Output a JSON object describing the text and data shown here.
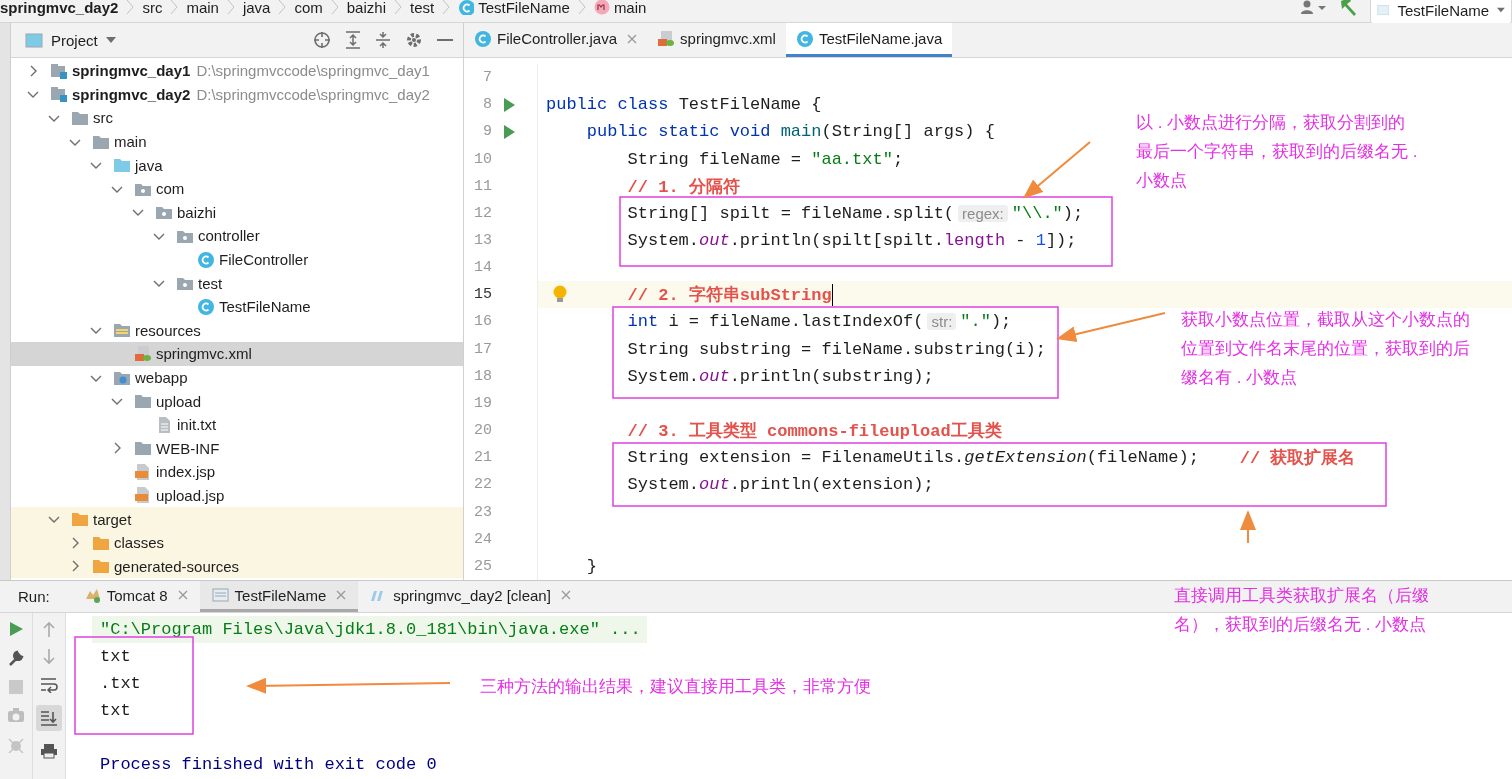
{
  "breadcrumbs": [
    {
      "text": "springmvc_day2",
      "kind": "module"
    },
    {
      "text": "src",
      "kind": "plain"
    },
    {
      "text": "main",
      "kind": "plain"
    },
    {
      "text": "java",
      "kind": "plain"
    },
    {
      "text": "com",
      "kind": "plain"
    },
    {
      "text": "baizhi",
      "kind": "plain"
    },
    {
      "text": "test",
      "kind": "plain"
    },
    {
      "text": "TestFileName",
      "kind": "class"
    },
    {
      "text": "main",
      "kind": "method"
    }
  ],
  "run_config": {
    "label": "TestFileName"
  },
  "project_panel": {
    "title": "Project",
    "tree": [
      {
        "label": "springmvc_day1",
        "path": "D:\\springmvccode\\springmvc_day1",
        "kind": "module",
        "expanded": false,
        "selected": false
      },
      {
        "label": "springmvc_day2",
        "path": "D:\\springmvccode\\springmvc_day2",
        "kind": "module",
        "expanded": true,
        "selected": false,
        "children": [
          {
            "label": "src",
            "kind": "folder",
            "expanded": true,
            "selected": false,
            "children": [
              {
                "label": "main",
                "kind": "folder",
                "expanded": true,
                "selected": false,
                "children": [
                  {
                    "label": "java",
                    "kind": "source-folder",
                    "expanded": true,
                    "selected": false,
                    "children": [
                      {
                        "label": "com",
                        "kind": "package",
                        "expanded": true,
                        "selected": false,
                        "children": [
                          {
                            "label": "baizhi",
                            "kind": "package",
                            "expanded": true,
                            "selected": false,
                            "children": [
                              {
                                "label": "controller",
                                "kind": "package",
                                "expanded": true,
                                "selected": false,
                                "children": [
                                  {
                                    "label": "FileController",
                                    "kind": "class",
                                    "selected": false
                                  }
                                ]
                              },
                              {
                                "label": "test",
                                "kind": "package",
                                "expanded": true,
                                "selected": false,
                                "children": [
                                  {
                                    "label": "TestFileName",
                                    "kind": "class",
                                    "selected": false
                                  }
                                ]
                              }
                            ]
                          }
                        ]
                      }
                    ]
                  },
                  {
                    "label": "resources",
                    "kind": "resources-folder",
                    "expanded": true,
                    "selected": false,
                    "children": [
                      {
                        "label": "springmvc.xml",
                        "kind": "xml",
                        "selected": true
                      }
                    ]
                  },
                  {
                    "label": "webapp",
                    "kind": "web-folder",
                    "expanded": true,
                    "selected": false,
                    "children": [
                      {
                        "label": "upload",
                        "kind": "folder",
                        "expanded": true,
                        "selected": false,
                        "children": [
                          {
                            "label": "init.txt",
                            "kind": "text-file",
                            "selected": false
                          }
                        ]
                      },
                      {
                        "label": "WEB-INF",
                        "kind": "folder",
                        "expanded": false,
                        "selected": false
                      },
                      {
                        "label": "index.jsp",
                        "kind": "jsp",
                        "selected": false
                      },
                      {
                        "label": "upload.jsp",
                        "kind": "jsp",
                        "selected": false
                      }
                    ]
                  }
                ]
              }
            ]
          },
          {
            "label": "target",
            "kind": "excluded-folder",
            "expanded": true,
            "selected": false,
            "children": [
              {
                "label": "classes",
                "kind": "excluded-folder",
                "expanded": false,
                "selected": false
              },
              {
                "label": "generated-sources",
                "kind": "excluded-folder",
                "expanded": false,
                "selected": false
              }
            ]
          }
        ]
      }
    ]
  },
  "editor_tabs": [
    {
      "label": "FileController.java",
      "kind": "class",
      "selected": false,
      "close_button": true
    },
    {
      "label": "springmvc.xml",
      "kind": "xml",
      "selected": false,
      "close_button": false
    },
    {
      "label": "TestFileName.java",
      "kind": "class",
      "selected": true,
      "close_button": false
    }
  ],
  "code_lines": [
    {
      "number": "7",
      "run_marker": false,
      "current": false
    },
    {
      "number": "8",
      "run_marker": true,
      "current": false,
      "tokens": [
        {
          "text": "public class ",
          "kind": "keyword"
        },
        {
          "text": "TestFileName {",
          "kind": "plain"
        }
      ]
    },
    {
      "number": "9",
      "run_marker": true,
      "current": false,
      "tokens": [
        {
          "text": "    public static void ",
          "kind": "keyword"
        },
        {
          "text": "main",
          "kind": "declaration"
        },
        {
          "text": "(String[] args) {",
          "kind": "plain"
        }
      ]
    },
    {
      "number": "10",
      "run_marker": false,
      "current": false,
      "tokens": [
        {
          "text": "        String fileName = ",
          "kind": "plain"
        },
        {
          "text": "\"aa.txt\"",
          "kind": "string"
        },
        {
          "text": ";",
          "kind": "plain"
        }
      ]
    },
    {
      "number": "11",
      "run_marker": false,
      "current": false,
      "tokens": [
        {
          "text": "        // 1. 分隔符",
          "kind": "comment"
        }
      ]
    },
    {
      "number": "12",
      "run_marker": false,
      "current": false,
      "tokens": [
        {
          "text": "        String[] spilt = fileName.split(",
          "kind": "plain"
        },
        {
          "text": "regex:",
          "kind": "hint"
        },
        {
          "text": "\"\\\\.\"",
          "kind": "string"
        },
        {
          "text": ");",
          "kind": "plain"
        }
      ]
    },
    {
      "number": "13",
      "run_marker": false,
      "current": false,
      "tokens": [
        {
          "text": "        System.",
          "kind": "plain"
        },
        {
          "text": "out",
          "kind": "static-field"
        },
        {
          "text": ".println(spilt[spilt.",
          "kind": "plain"
        },
        {
          "text": "length",
          "kind": "field"
        },
        {
          "text": " - ",
          "kind": "plain"
        },
        {
          "text": "1",
          "kind": "number"
        },
        {
          "text": "]);",
          "kind": "plain"
        }
      ]
    },
    {
      "number": "14",
      "run_marker": false,
      "current": false
    },
    {
      "number": "15",
      "run_marker": false,
      "current": true,
      "tokens": [
        {
          "text": "        // 2. 字符串subString",
          "kind": "comment"
        }
      ]
    },
    {
      "number": "16",
      "run_marker": false,
      "current": false,
      "tokens": [
        {
          "text": "        int",
          "kind": "keyword"
        },
        {
          "text": " i = fileName.lastIndexOf(",
          "kind": "plain"
        },
        {
          "text": "str:",
          "kind": "hint"
        },
        {
          "text": "\".\"",
          "kind": "string"
        },
        {
          "text": ");",
          "kind": "plain"
        }
      ]
    },
    {
      "number": "17",
      "run_marker": false,
      "current": false,
      "tokens": [
        {
          "text": "        String substring = fileName.substring(i);",
          "kind": "plain"
        }
      ]
    },
    {
      "number": "18",
      "run_marker": false,
      "current": false,
      "tokens": [
        {
          "text": "        System.",
          "kind": "plain"
        },
        {
          "text": "out",
          "kind": "static-field"
        },
        {
          "text": ".println(substring);",
          "kind": "plain"
        }
      ]
    },
    {
      "number": "19",
      "run_marker": false,
      "current": false
    },
    {
      "number": "20",
      "run_marker": false,
      "current": false,
      "tokens": [
        {
          "text": "        // 3. 工具类型 commons-fileupload工具类",
          "kind": "comment"
        }
      ]
    },
    {
      "number": "21",
      "run_marker": false,
      "current": false,
      "tokens": [
        {
          "text": "        String extension = FilenameUtils.",
          "kind": "plain"
        },
        {
          "text": "getExtension",
          "kind": "static-method"
        },
        {
          "text": "(fileName);    ",
          "kind": "plain"
        },
        {
          "text": "// 获取扩展名",
          "kind": "comment"
        }
      ]
    },
    {
      "number": "22",
      "run_marker": false,
      "current": false,
      "tokens": [
        {
          "text": "        System.",
          "kind": "plain"
        },
        {
          "text": "out",
          "kind": "static-field"
        },
        {
          "text": ".println(extension);",
          "kind": "plain"
        }
      ]
    },
    {
      "number": "23",
      "run_marker": false,
      "current": false
    },
    {
      "number": "24",
      "run_marker": false,
      "current": false
    },
    {
      "number": "25",
      "run_marker": false,
      "current": false,
      "tokens": [
        {
          "text": "    }",
          "kind": "plain"
        }
      ]
    }
  ],
  "run_panel": {
    "label": "Run:",
    "tabs": [
      {
        "label": "Tomcat 8",
        "kind": "tomcat",
        "selected": false
      },
      {
        "label": "TestFileName",
        "kind": "console",
        "selected": true
      },
      {
        "label": "springmvc_day2 [clean]",
        "kind": "maven",
        "selected": false
      }
    ],
    "console": [
      {
        "text": "\"C:\\Program Files\\Java\\jdk1.8.0_181\\bin\\java.exe\" ...",
        "kind": "command"
      },
      {
        "text": "txt",
        "kind": "output"
      },
      {
        "text": ".txt",
        "kind": "output"
      },
      {
        "text": "txt",
        "kind": "output"
      },
      {
        "kind": "blank"
      },
      {
        "text": "Process finished with exit code 0",
        "kind": "status"
      }
    ]
  },
  "annotations": [
    {
      "text": "以 . 小数点进行分隔，获取分割到的最后一个字符串，获取到的后缀名无 . 小数点",
      "kind": "split"
    },
    {
      "text": "获取小数点位置，截取从这个小数点的位置到文件名末尾的位置，获取到的后缀名有 . 小数点",
      "kind": "substring"
    },
    {
      "text": "直接调用工具类获取扩展名（后缀名），获取到的后缀名无 . 小数点",
      "kind": "utility"
    },
    {
      "text": "三种方法的输出结果，建议直接用工具类，非常方便",
      "kind": "output"
    }
  ]
}
